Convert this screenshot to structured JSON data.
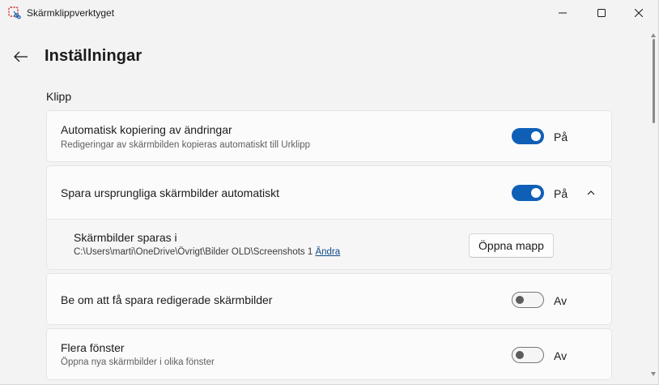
{
  "window": {
    "title": "Skärmklippverktyget"
  },
  "header": {
    "title": "Inställningar"
  },
  "section": {
    "title": "Klipp"
  },
  "settings": {
    "auto_copy": {
      "label": "Automatisk kopiering av ändringar",
      "description": "Redigeringar av skärmbilden kopieras automatiskt till Urklipp",
      "state": "on",
      "state_label": "På"
    },
    "auto_save": {
      "label": "Spara ursprungliga skärmbilder automatiskt",
      "state": "on",
      "state_label": "På",
      "expanded": true,
      "save_location_label": "Skärmbilder sparas i",
      "save_path": "C:\\Users\\marti\\OneDrive\\Övrigt\\Bilder OLD\\Screenshots 1",
      "change_link": "Ändra",
      "open_folder_button": "Öppna mapp"
    },
    "ask_save_edited": {
      "label": "Be om att få spara redigerade skärmbilder",
      "state": "off",
      "state_label": "Av"
    },
    "multiple_windows": {
      "label": "Flera fönster",
      "description": "Öppna nya skärmbilder i olika fönster",
      "state": "off",
      "state_label": "Av"
    }
  },
  "colors": {
    "accent": "#0f5fb7",
    "background": "#f3f3f3",
    "card": "#fbfbfb"
  }
}
